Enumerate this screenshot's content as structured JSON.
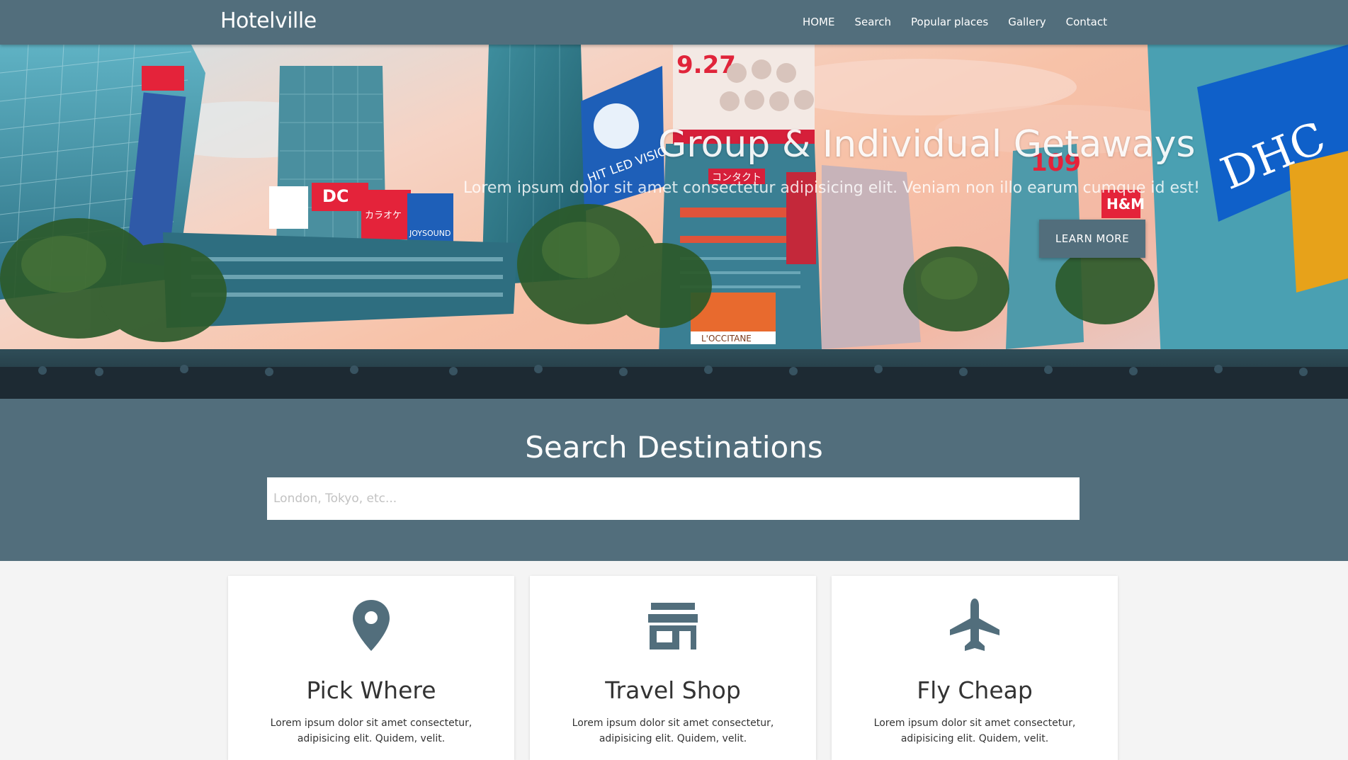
{
  "brand": "Hotelville",
  "nav": [
    {
      "label": "HOME"
    },
    {
      "label": "Search"
    },
    {
      "label": "Popular places"
    },
    {
      "label": "Gallery"
    },
    {
      "label": "Contact"
    }
  ],
  "hero": {
    "title": "Group & Individual Getaways",
    "subtitle": "Lorem ipsum dolor sit amet consectetur adipisicing elit. Veniam non illo earum cumque id est!",
    "button_label": "LEARN MORE",
    "signs": {
      "date_sign": "9.27",
      "hit_sign": "HIT LED VISION",
      "dc_sign": "DC",
      "karaoke_sign": "カラオケ",
      "joysound_sign": "JOYSOUND",
      "dhc_sign": "DHC",
      "sign_109": "109",
      "hm_sign": "H&M",
      "occitane_sign": "L'OCCITANE",
      "ichi_sign": "コンタクト"
    }
  },
  "search": {
    "title": "Search Destinations",
    "placeholder": "London, Tokyo, etc..."
  },
  "cards": [
    {
      "icon": "map-marker-icon",
      "title": "Pick Where",
      "text": "Lorem ipsum dolor sit amet consectetur, adipisicing elit. Quidem, velit."
    },
    {
      "icon": "store-icon",
      "title": "Travel Shop",
      "text": "Lorem ipsum dolor sit amet consectetur, adipisicing elit. Quidem, velit."
    },
    {
      "icon": "plane-icon",
      "title": "Fly Cheap",
      "text": "Lorem ipsum dolor sit amet consectetur, adipisicing elit. Quidem, velit."
    }
  ],
  "colors": {
    "primary": "#526e7c",
    "background": "#f4f4f4",
    "text": "#333333"
  }
}
